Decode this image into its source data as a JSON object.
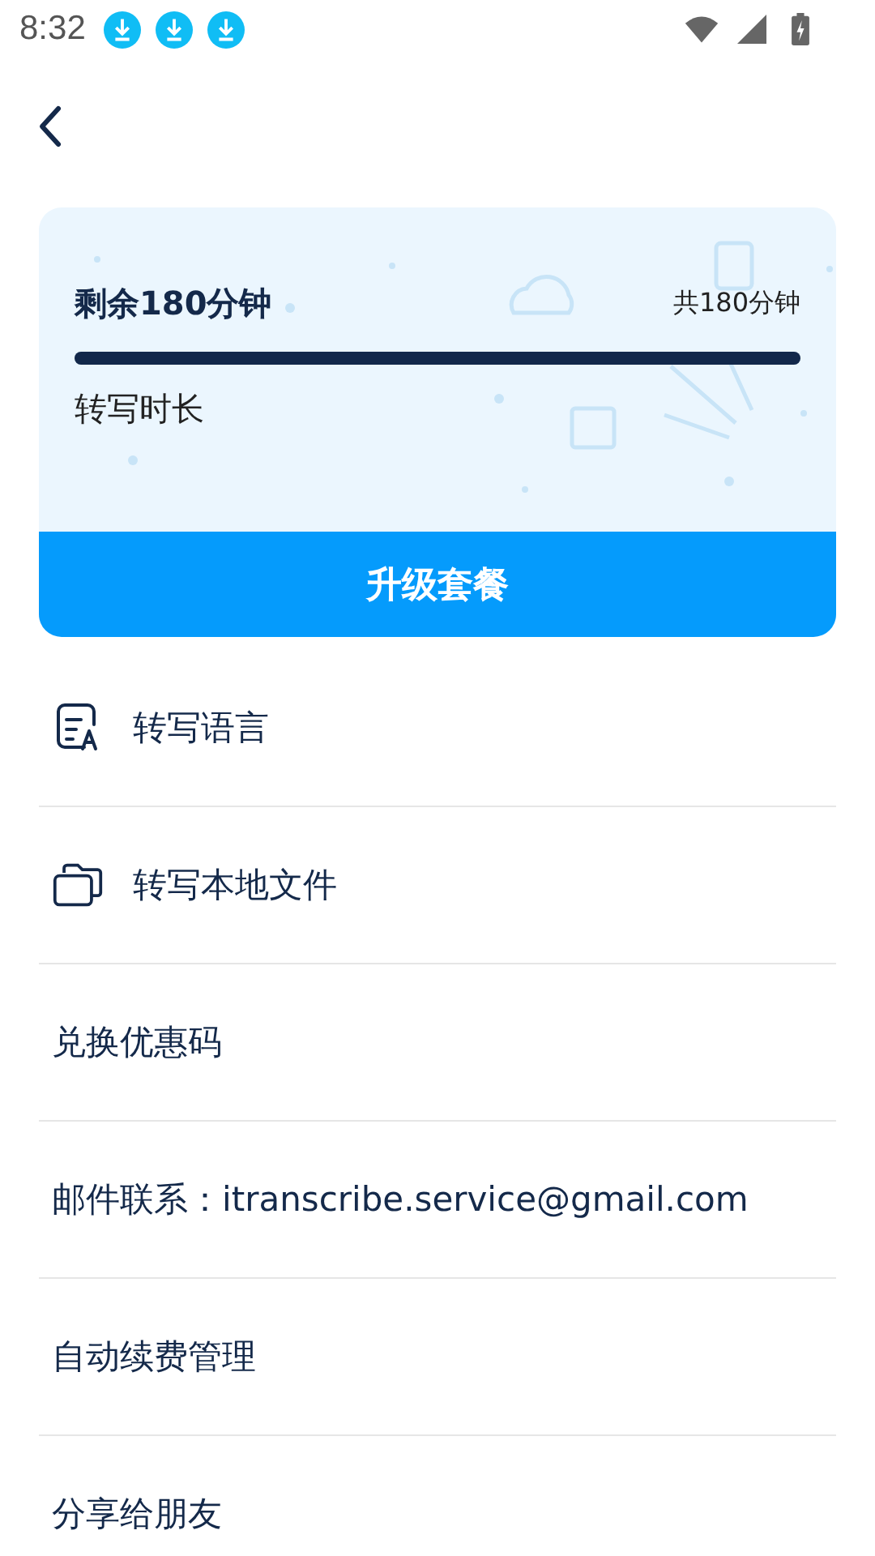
{
  "status_bar": {
    "time": "8:32",
    "notifications": [
      {
        "kind": "download"
      },
      {
        "kind": "download"
      },
      {
        "kind": "download"
      }
    ]
  },
  "quota_card": {
    "remaining": "剩余180分钟",
    "total": "共180分钟",
    "level": 1,
    "label": "转写时长",
    "upgrade_button": "升级套餐"
  },
  "menu": [
    {
      "kind": "language",
      "label": "转写语言"
    },
    {
      "kind": "files",
      "label": "转写本地文件"
    },
    {
      "kind": "plain",
      "label": "兑换优惠码"
    },
    {
      "kind": "plain",
      "label": "邮件联系：itranscribe.service@gmail.com"
    },
    {
      "kind": "plain",
      "label": "自动续费管理"
    },
    {
      "kind": "plain",
      "label": "分享给朋友"
    }
  ]
}
